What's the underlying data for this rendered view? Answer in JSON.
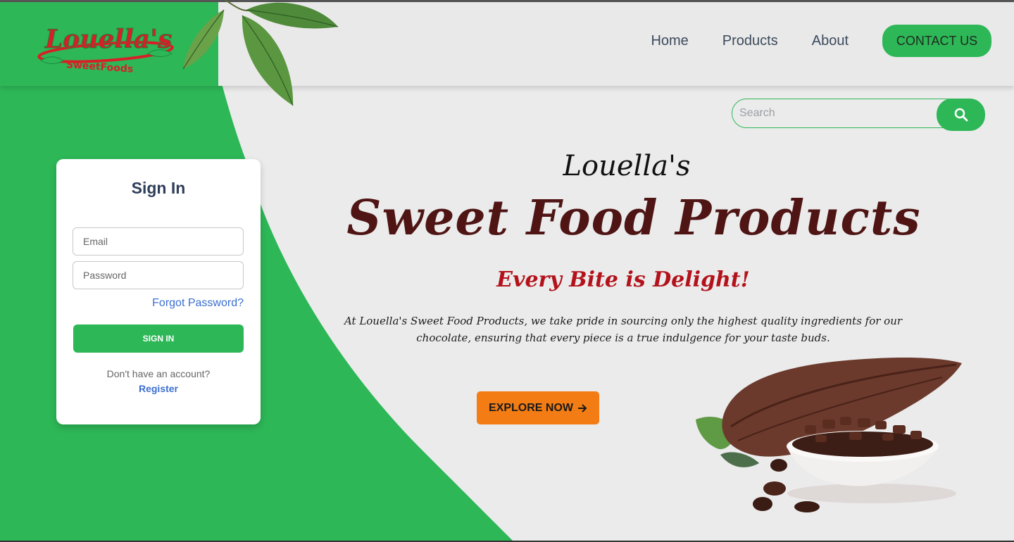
{
  "brand": {
    "logo_main": "Louella's",
    "logo_sub": "SweetFoods",
    "logo_colors": {
      "main": "#d81f26",
      "sub": "#d81f26",
      "leaf": "#2db757"
    }
  },
  "nav": {
    "items": [
      {
        "label": "Home"
      },
      {
        "label": "Products"
      },
      {
        "label": "About"
      }
    ],
    "contact_label": "CONTACT US"
  },
  "search": {
    "placeholder": "Search",
    "icon": "search-icon"
  },
  "signin": {
    "title": "Sign In",
    "email_placeholder": "Email",
    "password_placeholder": "Password",
    "forgot_label": "Forgot Password?",
    "button_label": "SIGN IN",
    "no_account_text": "Don't have an account?",
    "register_label": "Register"
  },
  "hero": {
    "small_title": "Louella's",
    "big_title": "Sweet Food Products",
    "tagline": "Every Bite is Delight!",
    "description": "At Louella's Sweet Food Products, we take pride in sourcing only the highest quality ingredients for our chocolate, ensuring that every piece is a true indulgence for your taste buds.",
    "cta_label": "EXPLORE NOW",
    "cta_icon": "arrow-right-icon"
  },
  "colors": {
    "brand_green": "#2db757",
    "cta_orange": "#f37d14",
    "title_maroon": "#4f1414",
    "tagline_red": "#b3121b",
    "link_blue": "#3b6fd0"
  }
}
